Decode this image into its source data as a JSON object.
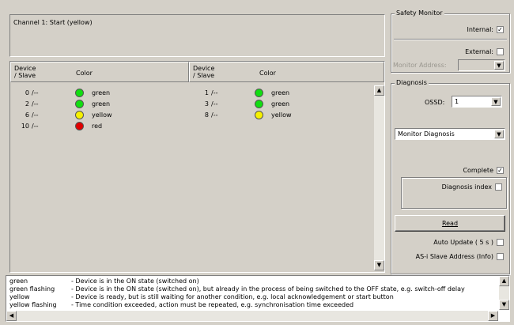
{
  "channel_panel": {
    "title": "Channel 1: Start (yellow)"
  },
  "table": {
    "col_device": [
      "Device",
      "/ Slave"
    ],
    "col_color": "Color",
    "left_rows": [
      {
        "device": "0",
        "slave": "/--",
        "color_name": "green",
        "led": "#11dd11"
      },
      {
        "device": "2",
        "slave": "/--",
        "color_name": "green",
        "led": "#11dd11"
      },
      {
        "device": "6",
        "slave": "/--",
        "color_name": "yellow",
        "led": "#f5f000"
      },
      {
        "device": "10",
        "slave": "/--",
        "color_name": "red",
        "led": "#e00000"
      }
    ],
    "right_rows": [
      {
        "device": "1",
        "slave": "/--",
        "color_name": "green",
        "led": "#11dd11"
      },
      {
        "device": "3",
        "slave": "/--",
        "color_name": "green",
        "led": "#11dd11"
      },
      {
        "device": "8",
        "slave": "/--",
        "color_name": "yellow",
        "led": "#f5f000"
      }
    ]
  },
  "safety_monitor": {
    "title": "Safety Monitor",
    "internal_label": "Internal:",
    "internal_checked": "✓",
    "external_label": "External:",
    "monitor_address_label": "Monitor Address:"
  },
  "diagnosis": {
    "title": "Diagnosis",
    "ossd_label": "OSSD:",
    "ossd_value": "1",
    "mode_value": "Monitor Diagnosis",
    "complete_label": "Complete",
    "complete_checked": "✓",
    "index_label": "Diagnosis index",
    "read_button": "Read",
    "auto_update_label": "Auto Update ( 5 s )",
    "asi_label": "AS-i Slave Address (Info)"
  },
  "legend": [
    {
      "term": "green",
      "desc": "- Device is in the ON state (switched on)"
    },
    {
      "term": "green flashing",
      "desc": "- Device is in the ON state (switched on), but already in the process of being switched to the OFF state, e.g. switch-off delay"
    },
    {
      "term": "yellow",
      "desc": "- Device is ready, but is still waiting for another condition, e.g. local acknowledgement or start button"
    },
    {
      "term": "yellow flashing",
      "desc": "- Time condition exceeded, action must be repeated, e.g. synchronisation time exceeded"
    }
  ]
}
